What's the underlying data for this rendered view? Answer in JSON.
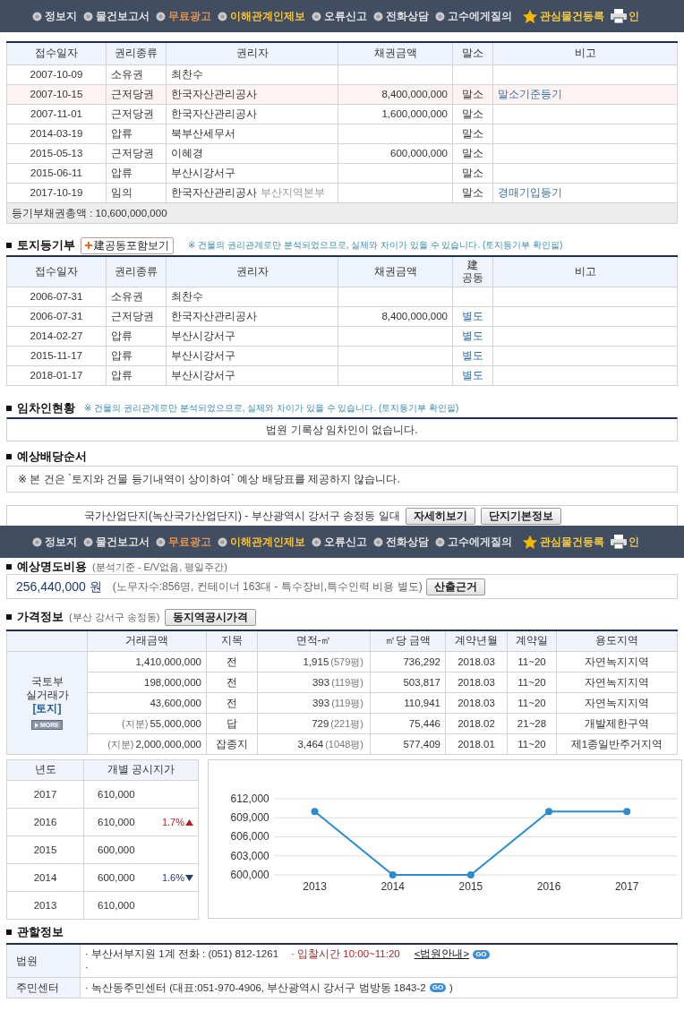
{
  "nav_bars": [
    {
      "items": [
        {
          "label": "정보지",
          "color": "#e2e2e2"
        },
        {
          "label": "물건보고서",
          "color": "#e2e2e2"
        },
        {
          "label": "무료광고",
          "color": "#e8914a"
        },
        {
          "label": "이해관계인제보",
          "color": "#f2c343"
        },
        {
          "label": "오류신고",
          "color": "#e2e2e2"
        },
        {
          "label": "전화상담",
          "color": "#e2e2e2"
        },
        {
          "label": "고수에게질의",
          "color": "#e2e2e2"
        }
      ],
      "watch_label": "관심물건등록",
      "print_label": "인"
    },
    {
      "items": [
        {
          "label": "정보지",
          "color": "#e2e2e2"
        },
        {
          "label": "물건보고서",
          "color": "#e2e2e2"
        },
        {
          "label": "무료광고",
          "color": "#e8914a"
        },
        {
          "label": "이해관계인제보",
          "color": "#f2c343"
        },
        {
          "label": "오류신고",
          "color": "#e2e2e2"
        },
        {
          "label": "전화상담",
          "color": "#e2e2e2"
        },
        {
          "label": "고수에게질의",
          "color": "#e2e2e2"
        }
      ],
      "watch_label": "관심물건등록",
      "print_label": "인"
    }
  ],
  "building_register": {
    "columns": [
      "접수일자",
      "권리종류",
      "권리자",
      "채권금액",
      "말소",
      "비고"
    ],
    "rows": [
      {
        "date": "2007-10-09",
        "type": "소유권",
        "holder": "최찬수",
        "highlighted": false
      },
      {
        "date": "2007-10-15",
        "type": "근저당권",
        "holder": "한국자산관리공사",
        "amount": "8,400,000,000",
        "cancel": "말소",
        "remark": "말소기준등기",
        "highlighted": true
      },
      {
        "date": "2007-11-01",
        "type": "근저당권",
        "holder": "한국자산관리공사",
        "amount": "1,600,000,000",
        "cancel": "말소",
        "highlighted": false
      },
      {
        "date": "2014-03-19",
        "type": "압류",
        "holder": "북부산세무서",
        "cancel": "말소",
        "highlighted": false
      },
      {
        "date": "2015-05-13",
        "type": "근저당권",
        "holder": "이혜경",
        "amount": "600,000,000",
        "cancel": "말소",
        "highlighted": false
      },
      {
        "date": "2015-06-11",
        "type": "압류",
        "holder": "부산시강서구",
        "cancel": "말소",
        "highlighted": false
      },
      {
        "date": "2017-10-19",
        "type": "임의",
        "holder": "한국자산관리공사",
        "holder_note": "부산지역본부",
        "cancel": "말소",
        "remark": "경매기입등기",
        "highlighted": false
      }
    ],
    "total": "등기부채권총액 : 10,600,000,000"
  },
  "land_register": {
    "title": "토지등기부",
    "button": "建공동포함보기",
    "note": "※ 건물의 권리관계로만 분석되었으므로, 실제와 차이가 있을 수 있습니다. (토지등기부 확인필)",
    "columns": [
      "접수일자",
      "권리종류",
      "권리자",
      "채권금액",
      "建\n공동",
      "비고"
    ],
    "rows": [
      {
        "date": "2006-07-31",
        "type": "소유권",
        "holder": "최찬수"
      },
      {
        "date": "2006-07-31",
        "type": "근저당권",
        "holder": "한국자산관리공사",
        "amount": "8,400,000,000",
        "joint": "별도"
      },
      {
        "date": "2014-02-27",
        "type": "압류",
        "holder": "부산시강서구",
        "joint": "별도"
      },
      {
        "date": "2015-11-17",
        "type": "압류",
        "holder": "부산시강서구",
        "joint": "별도"
      },
      {
        "date": "2018-01-17",
        "type": "압류",
        "holder": "부산시강서구",
        "joint": "별도"
      }
    ]
  },
  "tenants": {
    "title": "임차인현황",
    "note": "※ 건물의 권리관계로만 분석되었으므로, 실제와 차이가 있을 수 있습니다. (토지등기부 확인필)",
    "message": "법원 기록상 임차인이 없습니다."
  },
  "dividend": {
    "title": "예상배당순서",
    "message": "※ 본 건은 `토지와 건물 등기내역이 상이하여` 예상 배당표를 제공하지 않습니다."
  },
  "development": {
    "text": "국가산업단지(녹산국가산업단지) - 부산광역시 강서구 송정동 일대",
    "buttons": [
      "자세히보기",
      "단지기본정보"
    ]
  },
  "eviction": {
    "title": "예상명도비용",
    "subtitle": "(분석기준 - E/V없음, 평일주간)",
    "amount": "256,440,000 원",
    "note": "(노무자수:856명, 컨테이너 163대 - 특수장비,특수인력 비용 별도)",
    "button": "산출근거"
  },
  "price_info": {
    "title": "가격정보",
    "subtitle": "(부산 강서구 송정동)",
    "button": "동지역공시가격",
    "columns": [
      "거래금액",
      "지목",
      "면적-㎡",
      "㎡당 금액",
      "계약년월",
      "계약일",
      "용도지역"
    ],
    "side_label": [
      "국토부",
      "실거래가"
    ],
    "side_link": "[토지]",
    "more": "MORE",
    "rows": [
      {
        "amount": "1,410,000,000",
        "category": "전",
        "area": "1,915",
        "pyeong": "(579평)",
        "unit_price": "736,292",
        "month": "2018.03",
        "days": "11~20",
        "zone": "자연녹지지역"
      },
      {
        "amount": "198,000,000",
        "category": "전",
        "area": "393",
        "pyeong": "(119평)",
        "unit_price": "503,817",
        "month": "2018.03",
        "days": "11~20",
        "zone": "자연녹지지역"
      },
      {
        "amount": "43,600,000",
        "category": "전",
        "area": "393",
        "pyeong": "(119평)",
        "unit_price": "110,941",
        "month": "2018.03",
        "days": "11~20",
        "zone": "자연녹지지역"
      },
      {
        "share": "(지분)",
        "amount": "55,000,000",
        "category": "답",
        "area": "729",
        "pyeong": "(221평)",
        "unit_price": "75,446",
        "month": "2018.02",
        "days": "21~28",
        "zone": "개발제한구역"
      },
      {
        "share": "(지분)",
        "amount": "2,000,000,000",
        "category": "잡종지",
        "area": "3,464",
        "pyeong": "(1048평)",
        "unit_price": "577,409",
        "month": "2018.01",
        "days": "11~20",
        "zone": "제1종일반주거지역"
      }
    ]
  },
  "official_price": {
    "columns": [
      "년도",
      "개별 공시지가"
    ],
    "rows": [
      {
        "year": "2017",
        "price": "610,000"
      },
      {
        "year": "2016",
        "price": "610,000",
        "change": {
          "text": "1.7%",
          "rising": true
        }
      },
      {
        "year": "2015",
        "price": "600,000"
      },
      {
        "year": "2014",
        "price": "600,000",
        "change": {
          "text": "1.6%",
          "rising": false
        }
      },
      {
        "year": "2013",
        "price": "610,000"
      }
    ],
    "chart_data": {
      "type": "line",
      "categories": [
        "2013",
        "2014",
        "2015",
        "2016",
        "2017"
      ],
      "series": [
        {
          "color": "#2a8bd0",
          "marker": true,
          "values": [
            610000,
            600000,
            600000,
            610000,
            610000
          ]
        }
      ],
      "grid": true,
      "ylim": [
        600000,
        612000
      ],
      "yticks": [
        {
          "value": 600000,
          "label": "600,000"
        },
        {
          "value": 603000,
          "label": "603,000"
        },
        {
          "value": 606000,
          "label": "606,000"
        },
        {
          "value": 609000,
          "label": "609,000"
        },
        {
          "value": 612000,
          "label": "612,000"
        }
      ]
    }
  },
  "jurisdiction": {
    "title": "관할정보",
    "court": {
      "label": "법원",
      "info": "· 부산서부지원 1계 전화 : (051) 812-1261",
      "bid_time": "· 입찰시간 10:00~11:20",
      "link": "<법원안내>",
      "go": "GO",
      "second_line": "·"
    },
    "center": {
      "label": "주민센터",
      "info": "· 녹산동주민센터 (대표:051-970-4906, 부산광역시 강서구 범방동 1843-2",
      "go": "GO",
      "closing": ")"
    }
  }
}
